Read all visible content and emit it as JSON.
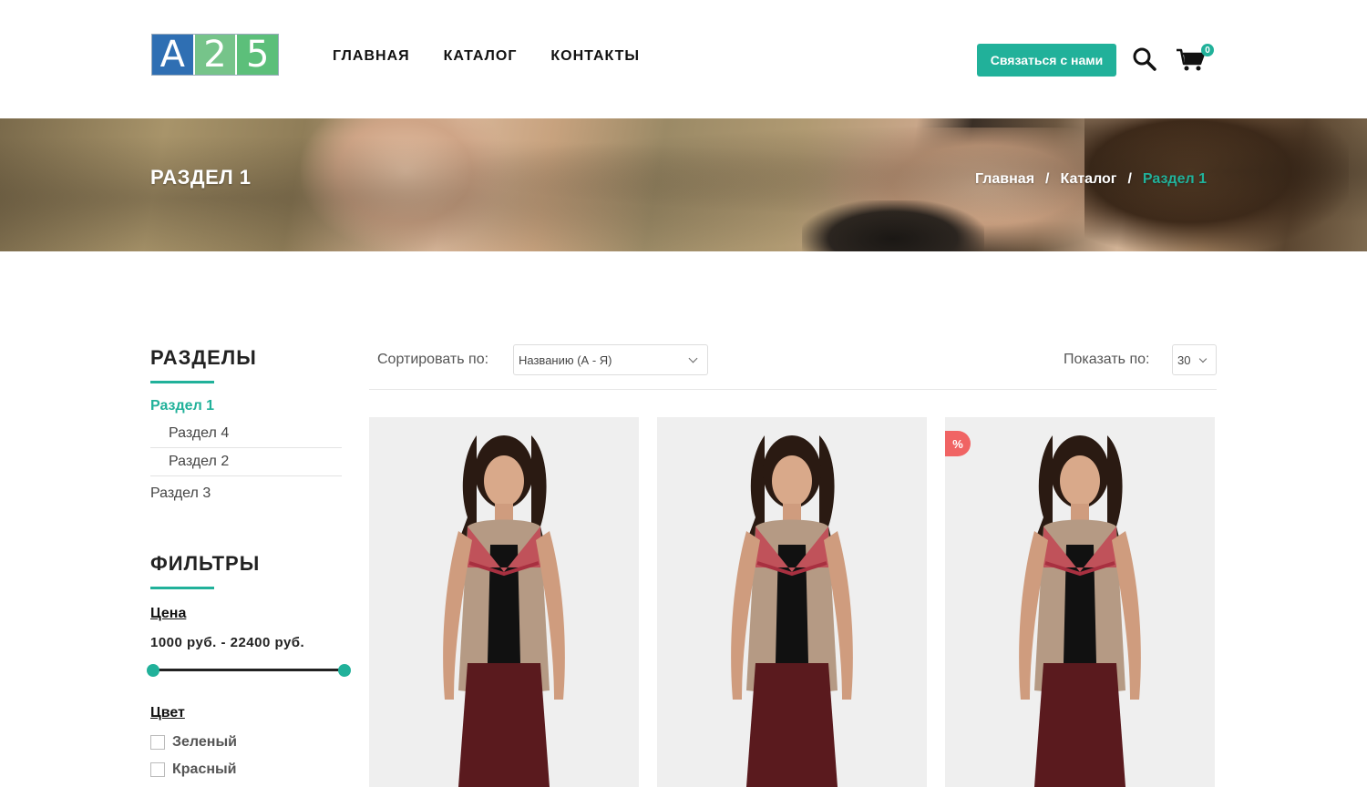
{
  "logo": {
    "chars": [
      "A",
      "2",
      "5"
    ]
  },
  "nav": {
    "items": [
      "ГЛАВНАЯ",
      "КАТАЛОГ",
      "КОНТАКТЫ"
    ]
  },
  "header": {
    "contact_button": "Связаться с нами",
    "cart_count": "0"
  },
  "banner": {
    "title": "РАЗДЕЛ 1",
    "breadcrumb": {
      "home": "Главная",
      "catalog": "Каталог",
      "current": "Раздел 1",
      "separator": "/"
    }
  },
  "sidebar": {
    "sections_heading": "РАЗДЕЛЫ",
    "categories": {
      "active": "Раздел 1",
      "sub1": "Раздел 4",
      "sub2": "Раздел 2",
      "other": "Раздел 3"
    },
    "filters_heading": "ФИЛЬТРЫ",
    "price_label": "Цена",
    "price_range": "1000 руб. - 22400 руб.",
    "color_label": "Цвет",
    "colors": [
      "Зеленый",
      "Красный"
    ]
  },
  "toolbar": {
    "sort_label": "Сортировать по:",
    "sort_value": "Названию (А - Я)",
    "show_label": "Показать по:",
    "show_value": "30"
  },
  "products": {
    "sale_badge": "%"
  },
  "colors": {
    "accent": "#21b19a",
    "sale": "#f06464"
  },
  "icons": [
    "search-icon",
    "cart-icon",
    "chevron-down-icon"
  ]
}
